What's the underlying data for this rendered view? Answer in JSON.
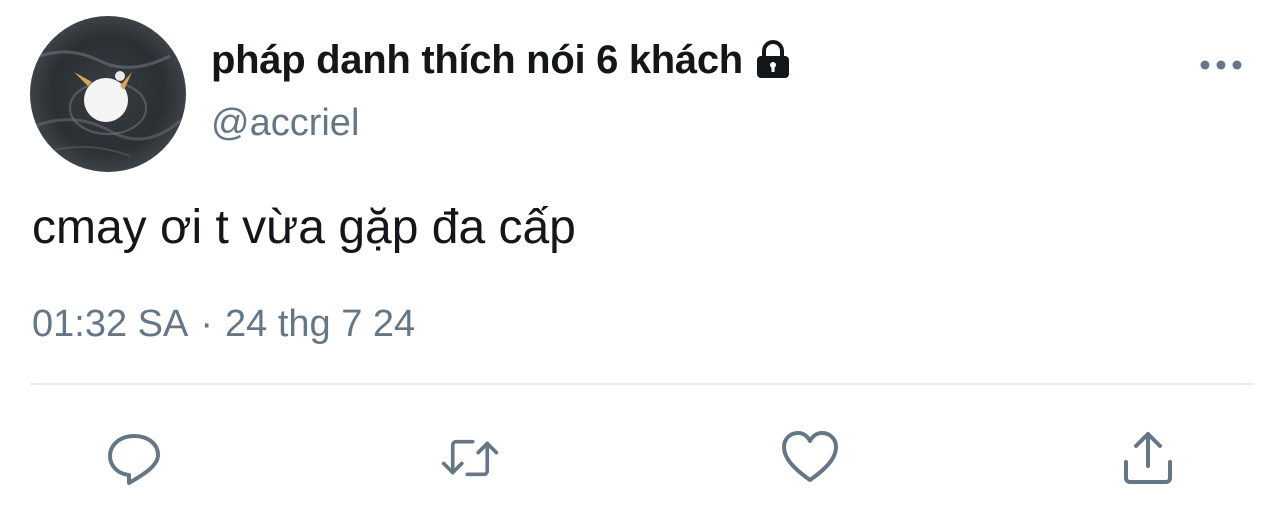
{
  "tweet": {
    "author": {
      "display_name": "pháp danh thích nói 6 khách",
      "handle": "@accriel",
      "protected_icon": "lock-icon",
      "avatar": "avatar-photo"
    },
    "text": "cmay ơi t vừa gặp đa cấp",
    "meta": {
      "time": "01:32 SA",
      "separator": "·",
      "date": "24 thg 7 24"
    },
    "menu_icon": "more-icon",
    "actions": [
      {
        "name": "reply",
        "icon": "reply-icon"
      },
      {
        "name": "retweet",
        "icon": "retweet-icon"
      },
      {
        "name": "like",
        "icon": "heart-icon"
      },
      {
        "name": "share",
        "icon": "share-icon"
      }
    ]
  },
  "colors": {
    "text_primary": "#14171a",
    "text_secondary": "#657786",
    "divider": "#e6ecf0",
    "icon": "#657786"
  }
}
